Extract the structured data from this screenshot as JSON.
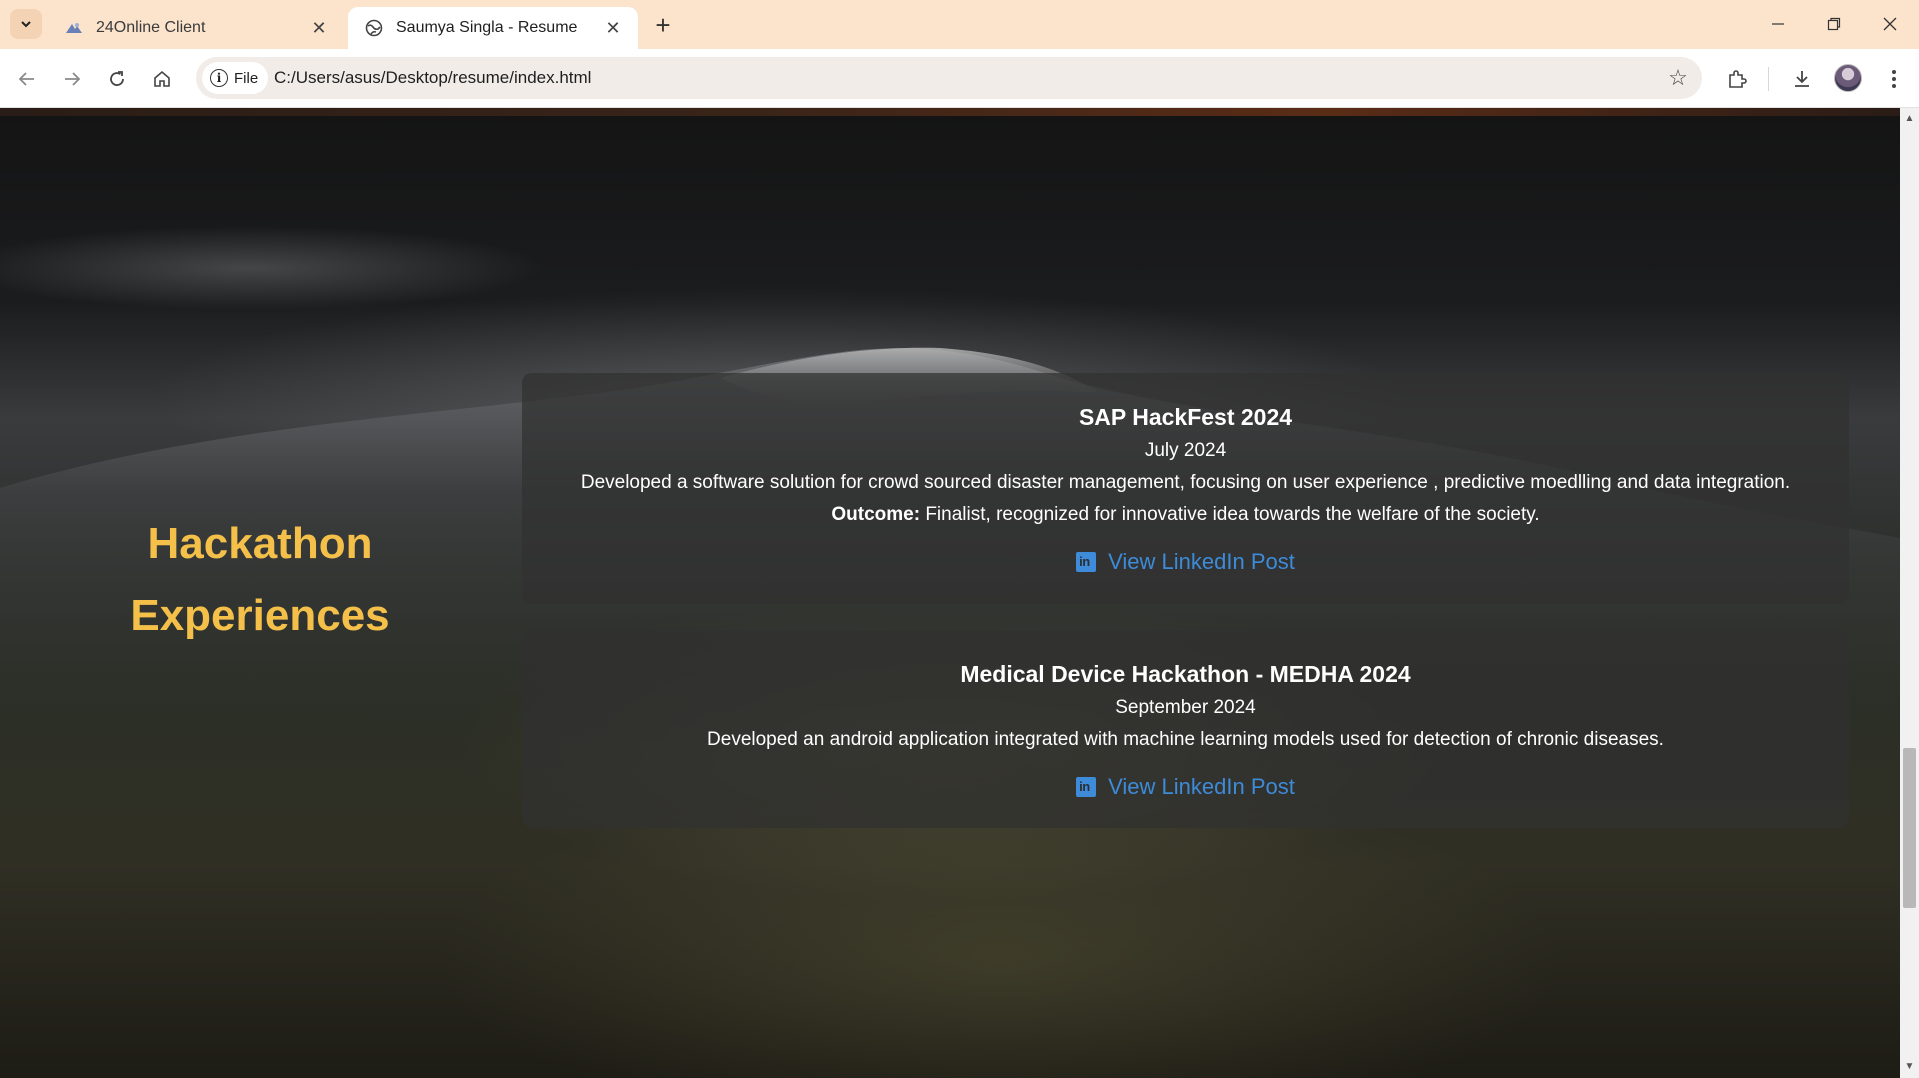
{
  "browser": {
    "tabs": [
      {
        "title": "24Online Client",
        "icon": "24online-favicon",
        "active": false
      },
      {
        "title": "Saumya Singla - Resume",
        "icon": "globe-icon",
        "active": true
      }
    ],
    "address": {
      "chip_label": "File",
      "url": "C:/Users/asus/Desktop/resume/index.html"
    }
  },
  "page": {
    "section_title_line1": "Hackathon",
    "section_title_line2": "Experiences",
    "hackathons": [
      {
        "title": "SAP HackFest 2024",
        "date": "July 2024",
        "description": "Developed a software solution for crowd sourced disaster management, focusing on user experience , predictive moedlling and data integration.",
        "outcome_label": "Outcome:",
        "outcome_text": "Finalist, recognized for innovative idea towards the welfare of the society.",
        "link_label": "View LinkedIn Post"
      },
      {
        "title": "Medical Device Hackathon - MEDHA 2024",
        "date": "September 2024",
        "description": "Developed an android application integrated with machine learning models used for detection of chronic diseases.",
        "link_label": "View LinkedIn Post"
      }
    ]
  },
  "colors": {
    "accent_title": "#f4c04a",
    "link": "#3d8bd9",
    "tabbar_bg": "#fbe3cc"
  }
}
